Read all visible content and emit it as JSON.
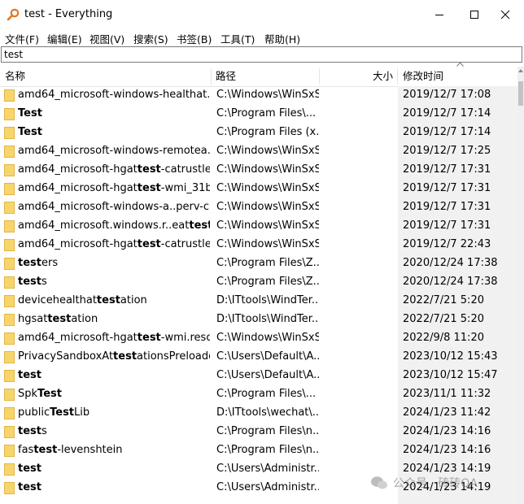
{
  "window": {
    "title": "test - Everything"
  },
  "menu": [
    "文件(F)",
    "编辑(E)",
    "视图(V)",
    "搜索(S)",
    "书签(B)",
    "工具(T)",
    "帮助(H)"
  ],
  "search": {
    "value": "test"
  },
  "columns": {
    "name": "名称",
    "path": "路径",
    "size": "大小",
    "modified": "修改时间"
  },
  "rows": [
    {
      "name": [
        [
          "amd64_microsoft-windows-healthat...",
          false
        ]
      ],
      "path": "C:\\Windows\\WinSxS",
      "date": "2019/12/7 17:08"
    },
    {
      "name": [
        [
          "Test",
          true
        ]
      ],
      "path": "C:\\Program Files\\...",
      "date": "2019/12/7 17:14"
    },
    {
      "name": [
        [
          "Test",
          true
        ]
      ],
      "path": "C:\\Program Files (x...",
      "date": "2019/12/7 17:14"
    },
    {
      "name": [
        [
          "amd64_microsoft-windows-remotea...",
          false
        ]
      ],
      "path": "C:\\Windows\\WinSxS",
      "date": "2019/12/7 17:25"
    },
    {
      "name": [
        [
          "amd64_microsoft-hgat",
          false
        ],
        [
          "test",
          true
        ],
        [
          "-catrustle...",
          false
        ]
      ],
      "path": "C:\\Windows\\WinSxS",
      "date": "2019/12/7 17:31"
    },
    {
      "name": [
        [
          "amd64_microsoft-hgat",
          false
        ],
        [
          "test",
          true
        ],
        [
          "-wmi_31b...",
          false
        ]
      ],
      "path": "C:\\Windows\\WinSxS",
      "date": "2019/12/7 17:31"
    },
    {
      "name": [
        [
          "amd64_microsoft-windows-a..perv-c...",
          false
        ]
      ],
      "path": "C:\\Windows\\WinSxS",
      "date": "2019/12/7 17:31"
    },
    {
      "name": [
        [
          "amd64_microsoft.windows.r..eat",
          false
        ],
        [
          "test",
          true
        ],
        [
          "...",
          false
        ]
      ],
      "path": "C:\\Windows\\WinSxS",
      "date": "2019/12/7 17:31"
    },
    {
      "name": [
        [
          "amd64_microsoft-hgat",
          false
        ],
        [
          "test",
          true
        ],
        [
          "-catrustle...",
          false
        ]
      ],
      "path": "C:\\Windows\\WinSxS",
      "date": "2019/12/7 22:43"
    },
    {
      "name": [
        [
          "test",
          true
        ],
        [
          "ers",
          false
        ]
      ],
      "path": "C:\\Program Files\\Z...",
      "date": "2020/12/24 17:38"
    },
    {
      "name": [
        [
          "test",
          true
        ],
        [
          "s",
          false
        ]
      ],
      "path": "C:\\Program Files\\Z...",
      "date": "2020/12/24 17:38"
    },
    {
      "name": [
        [
          "devicehealthat",
          false
        ],
        [
          "test",
          true
        ],
        [
          "ation",
          false
        ]
      ],
      "path": "D:\\ITtools\\WindTer...",
      "date": "2022/7/21 5:20"
    },
    {
      "name": [
        [
          "hgsat",
          false
        ],
        [
          "test",
          true
        ],
        [
          "ation",
          false
        ]
      ],
      "path": "D:\\ITtools\\WindTer...",
      "date": "2022/7/21 5:20"
    },
    {
      "name": [
        [
          "amd64_microsoft-hgat",
          false
        ],
        [
          "test",
          true
        ],
        [
          "-wmi.reso...",
          false
        ]
      ],
      "path": "C:\\Windows\\WinSxS",
      "date": "2022/9/8 11:20"
    },
    {
      "name": [
        [
          "PrivacySandboxAt",
          false
        ],
        [
          "test",
          true
        ],
        [
          "ationsPreloaded",
          false
        ]
      ],
      "path": "C:\\Users\\Default\\A...",
      "date": "2023/10/12 15:43"
    },
    {
      "name": [
        [
          "test",
          true
        ]
      ],
      "path": "C:\\Users\\Default\\A...",
      "date": "2023/10/12 15:47"
    },
    {
      "name": [
        [
          "Spk",
          false
        ],
        [
          "Test",
          true
        ]
      ],
      "path": "C:\\Program Files\\...",
      "date": "2023/11/1 11:32"
    },
    {
      "name": [
        [
          "public",
          false
        ],
        [
          "Test",
          true
        ],
        [
          "Lib",
          false
        ]
      ],
      "path": "D:\\ITtools\\wechat\\...",
      "date": "2024/1/23 11:42"
    },
    {
      "name": [
        [
          "test",
          true
        ],
        [
          "s",
          false
        ]
      ],
      "path": "C:\\Program Files\\n...",
      "date": "2024/1/23 14:16"
    },
    {
      "name": [
        [
          "fas",
          false
        ],
        [
          "test",
          true
        ],
        [
          "-levenshtein",
          false
        ]
      ],
      "path": "C:\\Program Files\\n...",
      "date": "2024/1/23 14:16"
    },
    {
      "name": [
        [
          "test",
          true
        ]
      ],
      "path": "C:\\Users\\Administr...",
      "date": "2024/1/23 14:19"
    },
    {
      "name": [
        [
          "test",
          true
        ]
      ],
      "path": "C:\\Users\\Administr...",
      "date": "2024/1/23 14:19"
    }
  ],
  "watermark": {
    "text": "公众号 · 砖砖QA"
  },
  "colors": {
    "folder": "#f7d56d",
    "folder_edge": "#e3b644",
    "date_column_bg": "#f1f1f1",
    "app_icon": "#e8731e"
  },
  "icons": {
    "app": "magnifier-icon",
    "minimize": "minimize-icon",
    "maximize": "maximize-icon",
    "close": "close-icon",
    "folder": "folder-icon"
  }
}
